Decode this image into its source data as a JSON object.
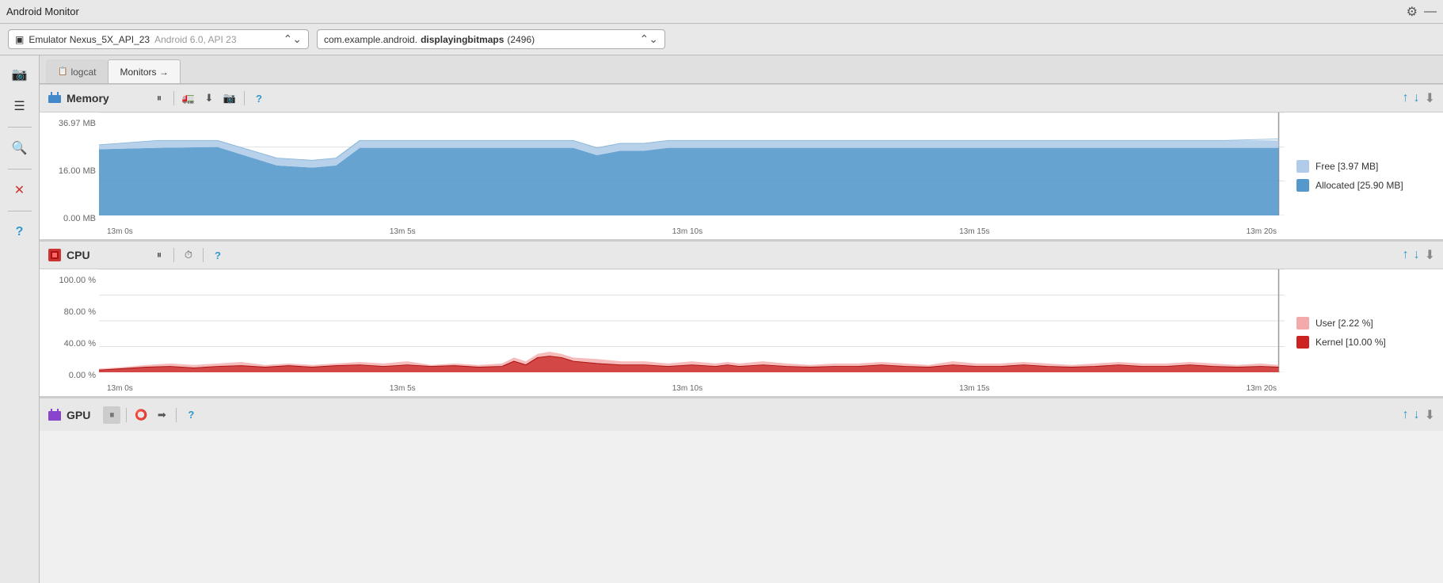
{
  "titleBar": {
    "title": "Android Monitor",
    "gearIcon": "⚙",
    "minimizeIcon": "—"
  },
  "deviceBar": {
    "deviceIcon": "📱",
    "deviceName": "Emulator Nexus_5X_API_23",
    "deviceOS": "Android 6.0, API 23",
    "processName": "com.example.android.",
    "processBold": "displayingbitmaps",
    "processPid": "(2496)"
  },
  "tabs": [
    {
      "label": "logcat",
      "active": false,
      "icon": "📋"
    },
    {
      "label": "Monitors →",
      "active": true
    }
  ],
  "memory": {
    "title": "Memory",
    "yLabels": [
      "36.97 MB",
      "16.00 MB",
      "0.00 MB"
    ],
    "xLabels": [
      "13m 0s",
      "13m 5s",
      "13m 10s",
      "13m 15s",
      "13m 20s"
    ],
    "legend": [
      {
        "label": "Free [3.97 MB]",
        "color": "#b0cce8"
      },
      {
        "label": "Allocated [25.90 MB]",
        "color": "#5599cc"
      }
    ]
  },
  "cpu": {
    "title": "CPU",
    "yLabels": [
      "100.00 %",
      "80.00 %",
      "40.00 %",
      "0.00 %"
    ],
    "xLabels": [
      "13m 0s",
      "13m 5s",
      "13m 10s",
      "13m 15s",
      "13m 20s"
    ],
    "legend": [
      {
        "label": "User [2.22 %]",
        "color": "#f4aaaa"
      },
      {
        "label": "Kernel [10.00 %]",
        "color": "#cc2222"
      }
    ]
  },
  "gpu": {
    "title": "GPU"
  },
  "controls": {
    "pauseLabel": "⏸",
    "helpLabel": "?",
    "clockLabel": "⏱",
    "truckLabel": "🚛",
    "downLoadLabel": "⬇",
    "cameraLabel": "📷",
    "upArrow": "↑",
    "downArrow": "↓",
    "exportArrow": "⬇"
  },
  "sidebar": {
    "cameraIcon": "📷",
    "listIcon": "≡",
    "searchIcon": "🔍",
    "closeIcon": "✕",
    "helpIcon": "?"
  }
}
